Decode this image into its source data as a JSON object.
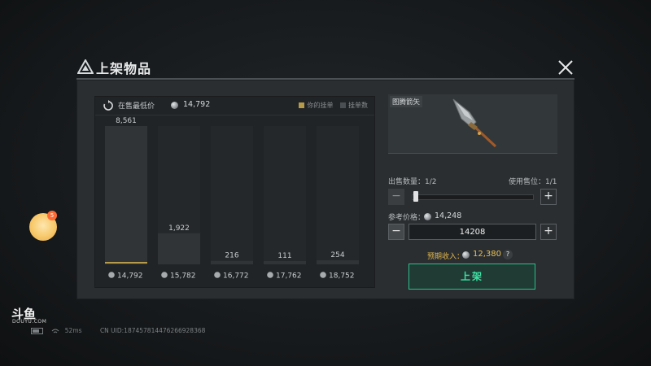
{
  "modal": {
    "title": "上架物品"
  },
  "chart_header": {
    "lowest_label": "在售最低价",
    "lowest_value": "14,792",
    "legend": [
      {
        "label": "你的挂单",
        "color": "#b59a4a"
      },
      {
        "label": "挂单数",
        "color": "#4a4f53"
      }
    ]
  },
  "chart_data": {
    "type": "bar",
    "categories": [
      "14,792",
      "15,782",
      "16,772",
      "17,762",
      "18,752"
    ],
    "values": [
      8561,
      1922,
      216,
      111,
      254
    ],
    "data_labels": [
      "8,561",
      "1,922",
      "216",
      "111",
      "254"
    ],
    "title": "",
    "xlabel": "",
    "ylabel": "",
    "ylim": [
      0,
      8561
    ],
    "highlight_index": 0,
    "bar_color": "#2f3336",
    "highlight_color": "#b59a4a",
    "grid": false
  },
  "item": {
    "name": "图腾箭矢"
  },
  "quantity": {
    "label": "出售数量：1/2",
    "slot_label": "使用售位：1/1",
    "level": 0.0
  },
  "price": {
    "ref_label": "参考价格：",
    "ref_value": "14,248",
    "input_value": "14208"
  },
  "income": {
    "label": "预期收入：",
    "value": "12,380",
    "help": "?"
  },
  "list_button": "上架",
  "overlay": {
    "avatar_badge": "5",
    "logo": "斗鱼",
    "logo_sub": "DOUYU.COM",
    "ping": "52ms",
    "uid": "CN UID:1874578144762669283​68"
  },
  "colors": {
    "accent_green": "#3ee3a6",
    "gold": "#e0b64c"
  }
}
